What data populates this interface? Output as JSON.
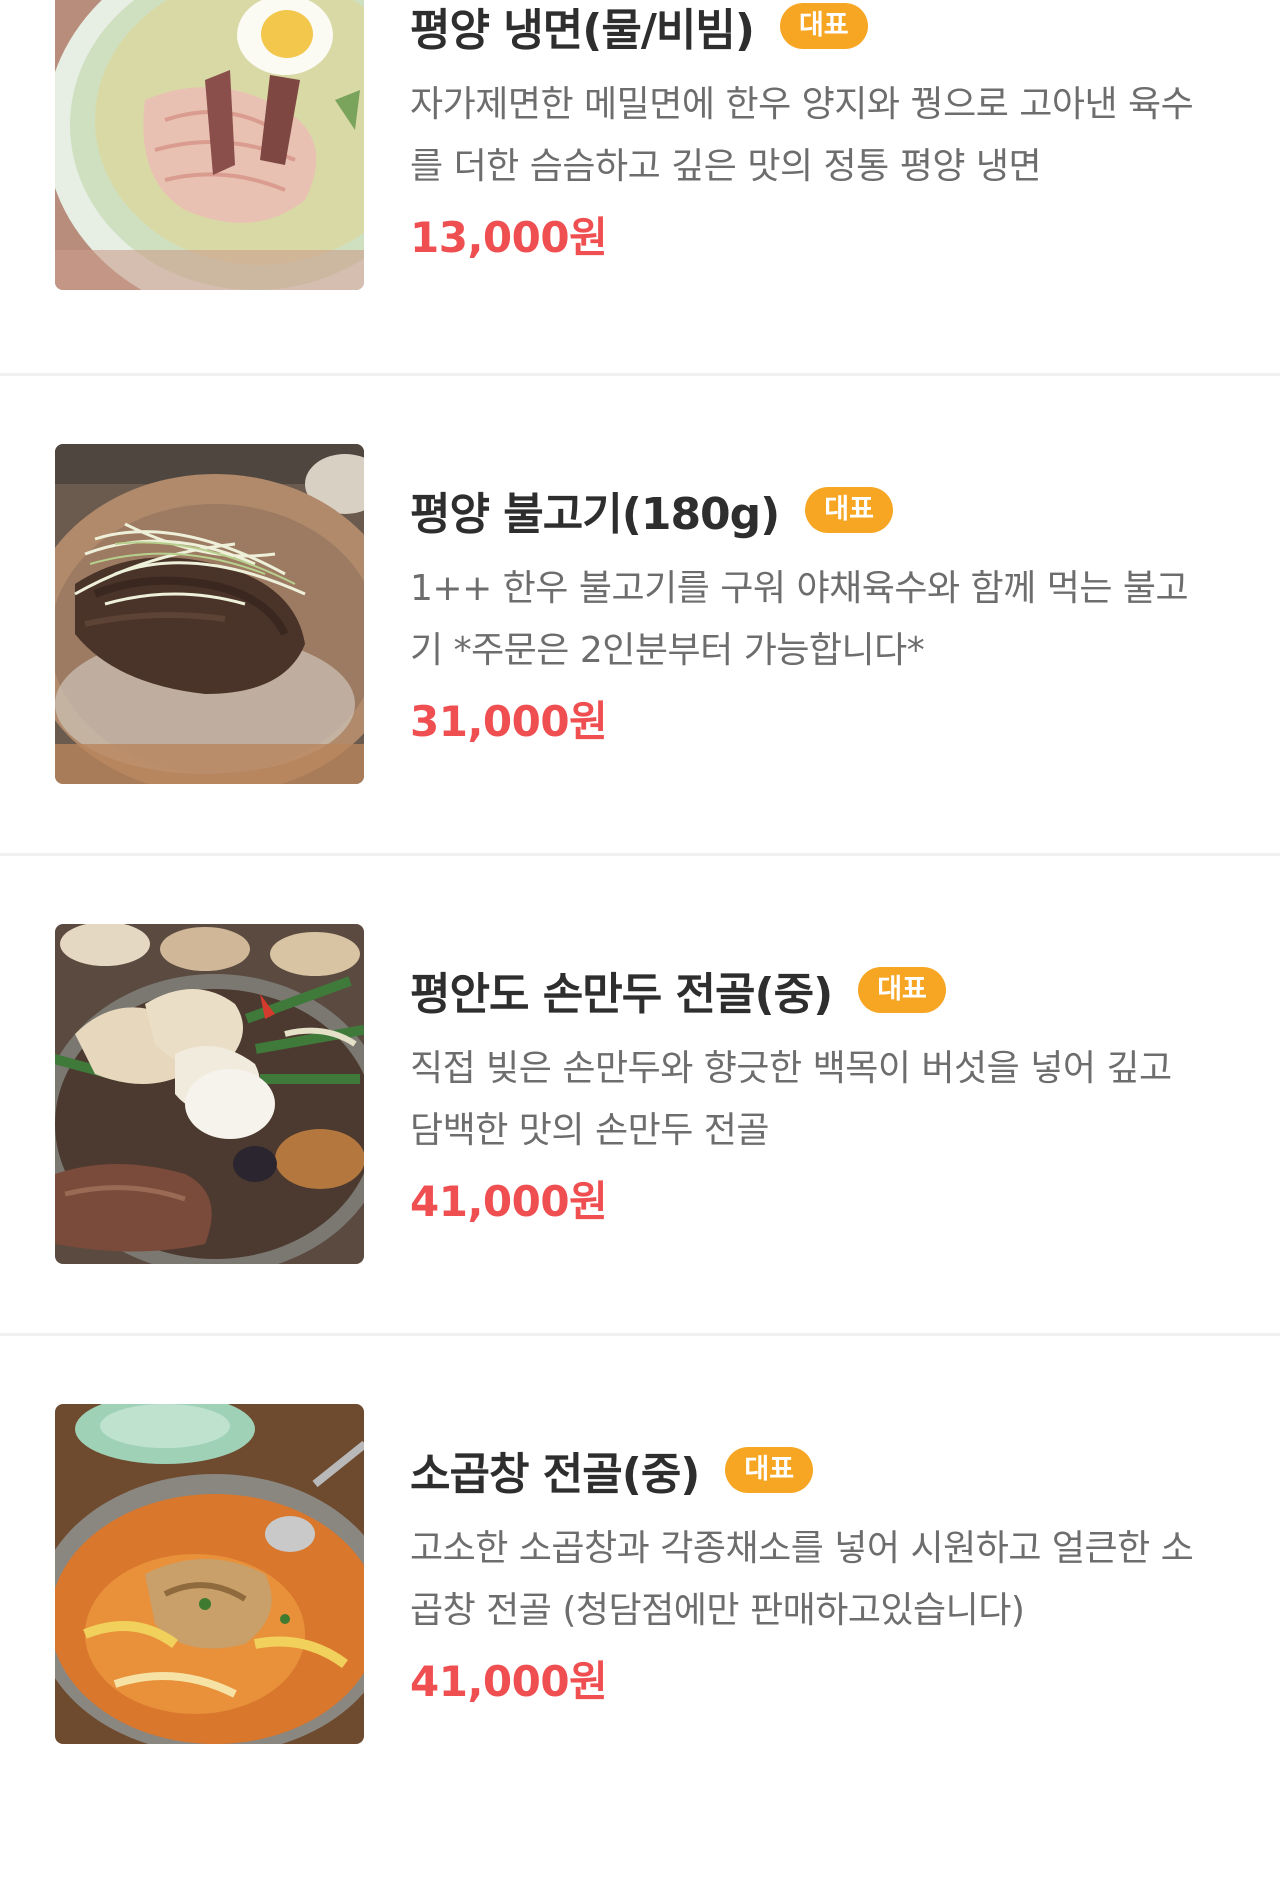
{
  "menu": {
    "items": [
      {
        "name": "평양 냉면(물/비빔)",
        "badge": "대표",
        "description": "자가제면한 메밀면에 한우 양지와 꿩으로 고아낸 육수를 더한 슴슴하고 깊은 맛의 정통 평양 냉면",
        "price": "13,000원",
        "image": "naengmyeon-bowl-photo"
      },
      {
        "name": "평양 불고기(180g)",
        "badge": "대표",
        "description": "1++ 한우 불고기를 구워 야채육수와 함께 먹는 불고기 *주문은 2인분부터 가능합니다*",
        "price": "31,000원",
        "image": "bulgogi-pan-photo"
      },
      {
        "name": "평안도 손만두 전골(중)",
        "badge": "대표",
        "description": "직접 빚은 손만두와 향긋한 백목이 버섯을 넣어 깊고 담백한 맛의 손만두 전골",
        "price": "41,000원",
        "image": "dumpling-hotpot-photo"
      },
      {
        "name": "소곱창 전골(중)",
        "badge": "대표",
        "description": "고소한 소곱창과 각종채소를 넣어 시원하고 얼큰한 소곱창 전골 (청담점에만 판매하고있습니다)",
        "price": "41,000원",
        "image": "gopchang-hotpot-photo"
      }
    ]
  },
  "colors": {
    "badge": "#f7a623",
    "price": "#ef4f51",
    "divider": "#eef0f2"
  }
}
